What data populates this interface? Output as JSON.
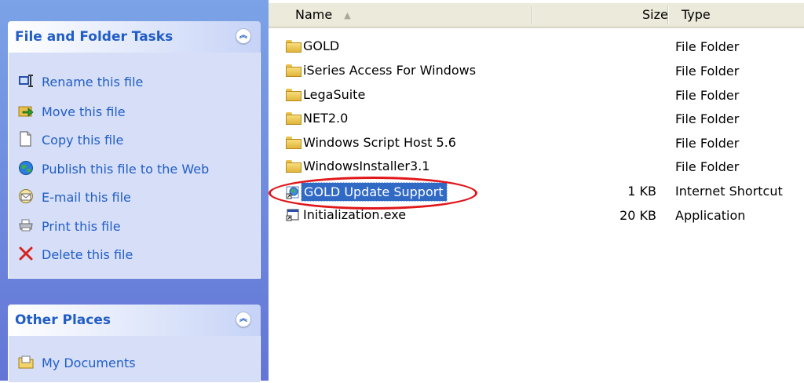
{
  "task_pane": {
    "file_folder_tasks": {
      "title": "File and Folder Tasks",
      "items": [
        {
          "label": "Rename this file",
          "icon": "rename-icon"
        },
        {
          "label": "Move this file",
          "icon": "move-icon"
        },
        {
          "label": "Copy this file",
          "icon": "copy-icon"
        },
        {
          "label": "Publish this file to the Web",
          "icon": "publish-web-icon"
        },
        {
          "label": "E-mail this file",
          "icon": "email-icon"
        },
        {
          "label": "Print this file",
          "icon": "print-icon"
        },
        {
          "label": "Delete this file",
          "icon": "delete-icon"
        }
      ]
    },
    "other_places": {
      "title": "Other Places",
      "items": [
        {
          "label": "My Documents",
          "icon": "my-documents-icon"
        }
      ]
    }
  },
  "file_list": {
    "columns": {
      "name": "Name",
      "size": "Size",
      "type": "Type"
    },
    "rows": [
      {
        "name": "GOLD",
        "size": "",
        "type": "File Folder",
        "icon": "folder-icon"
      },
      {
        "name": "iSeries Access For Windows",
        "size": "",
        "type": "File Folder",
        "icon": "folder-icon"
      },
      {
        "name": "LegaSuite",
        "size": "",
        "type": "File Folder",
        "icon": "folder-icon"
      },
      {
        "name": "NET2.0",
        "size": "",
        "type": "File Folder",
        "icon": "folder-icon"
      },
      {
        "name": "Windows Script Host 5.6",
        "size": "",
        "type": "File Folder",
        "icon": "folder-icon"
      },
      {
        "name": "WindowsInstaller3.1",
        "size": "",
        "type": "File Folder",
        "icon": "folder-icon"
      },
      {
        "name": "GOLD Update Support",
        "size": "1 KB",
        "type": "Internet Shortcut",
        "icon": "internet-shortcut-icon",
        "selected": true
      },
      {
        "name": "Initialization.exe",
        "size": "20 KB",
        "type": "Application",
        "icon": "application-icon"
      }
    ]
  },
  "colors": {
    "task_link": "#215dc6",
    "selection": "#316ac5",
    "annotation": "#e0161a"
  }
}
